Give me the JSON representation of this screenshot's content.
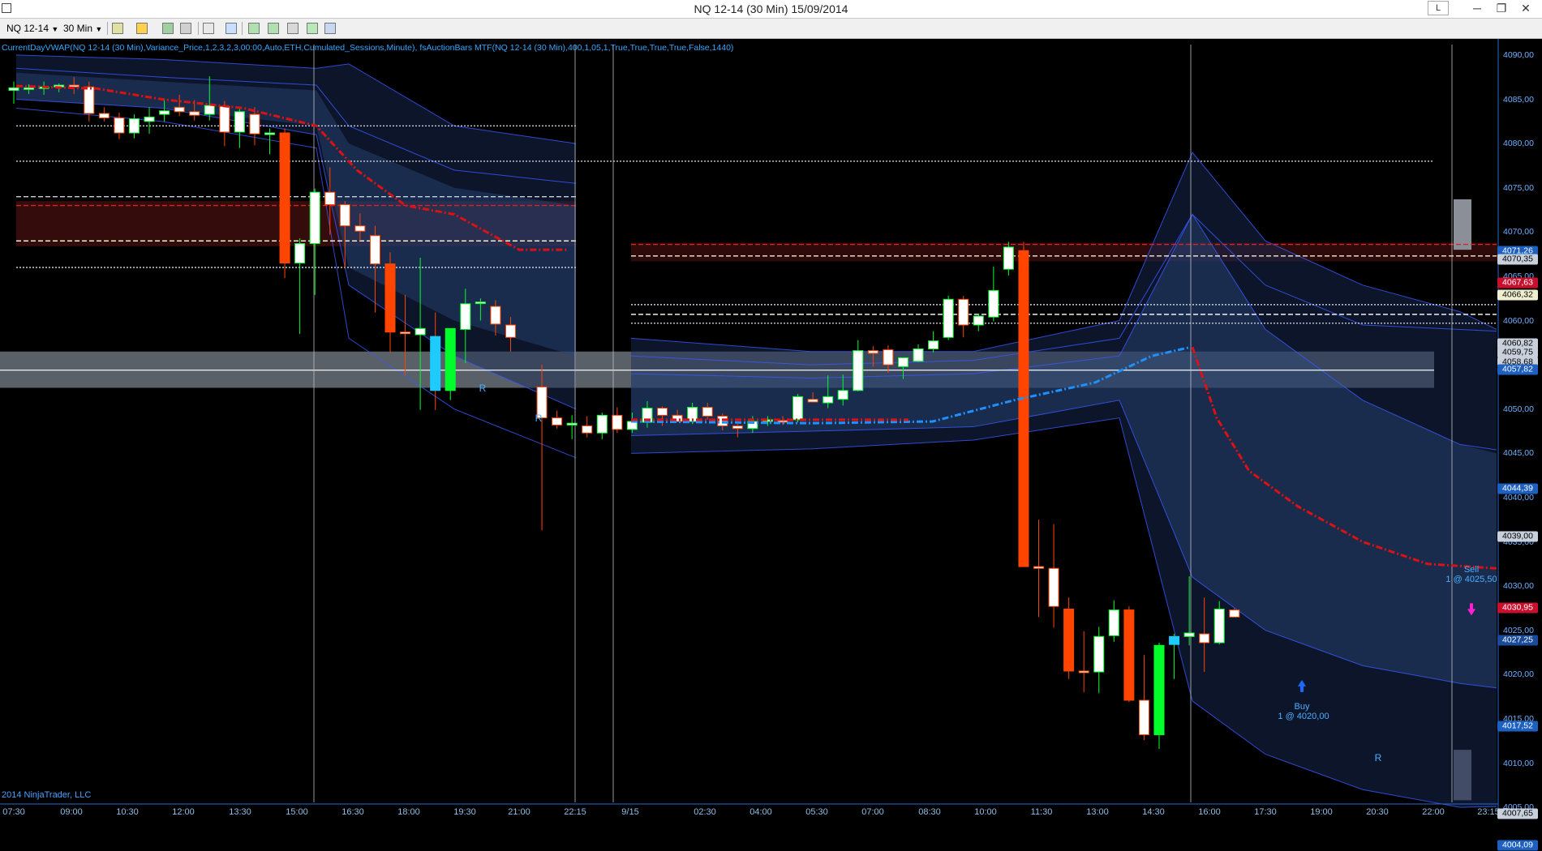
{
  "window": {
    "title": "NQ 12-14 (30 Min)  15/09/2014",
    "mode_button": "L",
    "minimize": "─",
    "restore": "❐",
    "close": "✕"
  },
  "toolbar": {
    "instrument": "NQ 12-14",
    "interval": "30 Min"
  },
  "indicator_text": "CurrentDayVWAP(NQ 12-14 (30 Min),Variance_Price,1,2,3,2,3,00:00,Auto,ETH,Cumulated_Sessions,Minute), fsAuctionBars MTF(NQ 12-14 (30 Min),400,1,05,1,True,True,True,True,False,1440)",
  "copyright": "2014 NinjaTrader, LLC",
  "time_axis": [
    "07:30",
    "09:00",
    "10:30",
    "12:00",
    "13:30",
    "15:00",
    "16:30",
    "18:00",
    "19:30",
    "21:00",
    "22:15",
    "9/15",
    "02:30",
    "04:00",
    "05:30",
    "07:00",
    "08:30",
    "10:00",
    "11:30",
    "13:00",
    "14:30",
    "16:00",
    "17:30",
    "19:00",
    "20:30",
    "22:00",
    "23:15"
  ],
  "price_axis": [
    "4090,00",
    "4085,00",
    "4080,00",
    "4075,00",
    "4070,00",
    "4065,00",
    "4060,00",
    "4055,00",
    "4050,00",
    "4045,00",
    "4040,00",
    "4035,00",
    "4030,00",
    "4025,00",
    "4020,00",
    "4015,00",
    "4010,00",
    "4005,00"
  ],
  "price_markers": [
    {
      "label": "4071,26",
      "bg": "#1e60c0",
      "fg": "#ffffff"
    },
    {
      "label": "4070,35",
      "bg": "#c8d0dc",
      "fg": "#000000"
    },
    {
      "label": "4067,63",
      "bg": "#c8102e",
      "fg": "#ffffff"
    },
    {
      "label": "4066,32",
      "bg": "#f0f0d0",
      "fg": "#000000"
    },
    {
      "label": "4060,82",
      "bg": "#c8d0dc",
      "fg": "#000000"
    },
    {
      "label": "4059,75",
      "bg": "#c8d0dc",
      "fg": "#000000"
    },
    {
      "label": "4058,68",
      "bg": "#c8d0dc",
      "fg": "#000000"
    },
    {
      "label": "4057,82",
      "bg": "#1e60c0",
      "fg": "#ffffff"
    },
    {
      "label": "4044,39",
      "bg": "#1e60c0",
      "fg": "#ffffff"
    },
    {
      "label": "4039,00",
      "bg": "#c8d0dc",
      "fg": "#000000"
    },
    {
      "label": "4030,95",
      "bg": "#c8102e",
      "fg": "#ffffff"
    },
    {
      "label": "4027,25",
      "bg": "#1a4a9a",
      "fg": "#ffffff"
    },
    {
      "label": "4017,52",
      "bg": "#1e60c0",
      "fg": "#ffffff"
    },
    {
      "label": "4007,65",
      "bg": "#c8d0dc",
      "fg": "#000000"
    },
    {
      "label": "4004,09",
      "bg": "#1e60c0",
      "fg": "#ffffff"
    }
  ],
  "annotations": {
    "sell_label": "Sell",
    "sell_detail": "1 @ 4025,50",
    "buy_label": "Buy",
    "buy_detail": "1 @ 4020,00",
    "r_marker": "R"
  },
  "colors": {
    "up": "#00ff2a",
    "down": "#ff4500",
    "vwap_day1": "#dd1111",
    "vwap_day2_blue": "#1e90ff",
    "band_line": "#3a5aff",
    "cyan_bar": "#1ecbff"
  },
  "chart_data": {
    "type": "candlestick",
    "title": "NQ 12-14 (30 Min)  15/09/2014",
    "y_axis_range": [
      4004,
      4091
    ],
    "candles": [
      {
        "t": "07:30",
        "o": 4085,
        "h": 4086,
        "l": 4083.5,
        "c": 4085.3
      },
      {
        "t": "08:00",
        "o": 4085.3,
        "h": 4085.7,
        "l": 4084.6,
        "c": 4085.3
      },
      {
        "t": "08:30",
        "o": 4085.3,
        "h": 4086,
        "l": 4084.5,
        "c": 4085.4
      },
      {
        "t": "09:00",
        "o": 4085.4,
        "h": 4085.8,
        "l": 4084.8,
        "c": 4085.6
      },
      {
        "t": "09:30",
        "o": 4085.6,
        "h": 4086.5,
        "l": 4084.6,
        "c": 4085.4
      },
      {
        "t": "10:00",
        "o": 4085.4,
        "h": 4086,
        "l": 4081.5,
        "c": 4082.4
      },
      {
        "t": "10:30",
        "o": 4082.4,
        "h": 4083.1,
        "l": 4081.5,
        "c": 4081.9
      },
      {
        "t": "11:00",
        "o": 4081.9,
        "h": 4082.5,
        "l": 4079.5,
        "c": 4080.2
      },
      {
        "t": "11:30",
        "o": 4080.2,
        "h": 4082.3,
        "l": 4079.6,
        "c": 4081.8
      },
      {
        "t": "12:00",
        "o": 4081.5,
        "h": 4083.1,
        "l": 4080.1,
        "c": 4082
      },
      {
        "t": "12:30",
        "o": 4082.3,
        "h": 4084.1,
        "l": 4081.5,
        "c": 4082.7
      },
      {
        "t": "13:00",
        "o": 4083.1,
        "h": 4084.5,
        "l": 4082.1,
        "c": 4082.6
      },
      {
        "t": "13:30",
        "o": 4082.6,
        "h": 4083.9,
        "l": 4081.6,
        "c": 4082.2
      },
      {
        "t": "14:00",
        "o": 4082.3,
        "h": 4086.6,
        "l": 4081.6,
        "c": 4083.3
      },
      {
        "t": "14:30",
        "o": 4083.2,
        "h": 4083.8,
        "l": 4078.7,
        "c": 4080.3
      },
      {
        "t": "15:00",
        "o": 4080.3,
        "h": 4082.9,
        "l": 4078.5,
        "c": 4082.6
      },
      {
        "t": "15:30",
        "o": 4082.3,
        "h": 4083.1,
        "l": 4078.8,
        "c": 4080.1
      },
      {
        "t": "16:00",
        "o": 4080.2,
        "h": 4080.7,
        "l": 4077.8,
        "c": 4080.2
      },
      {
        "t": "16:30",
        "o": 4080.2,
        "h": 4080.7,
        "l": 4063.8,
        "c": 4065.5
      },
      {
        "t": "17:00",
        "o": 4065.5,
        "h": 4068.3,
        "l": 4057.5,
        "c": 4067.7
      },
      {
        "t": "17:30",
        "o": 4067.7,
        "h": 4073.9,
        "l": 4061.9,
        "c": 4073.5
      },
      {
        "t": "18:00",
        "o": 4073.5,
        "h": 4076.3,
        "l": 4068.7,
        "c": 4072.1
      },
      {
        "t": "18:30",
        "o": 4072.1,
        "h": 4072.5,
        "l": 4064.9,
        "c": 4069.7
      },
      {
        "t": "19:00",
        "o": 4069.7,
        "h": 4071.1,
        "l": 4068,
        "c": 4069.1
      },
      {
        "t": "19:30",
        "o": 4068.6,
        "h": 4069.7,
        "l": 4059.9,
        "c": 4065.4
      },
      {
        "t": "20:00",
        "o": 4065.4,
        "h": 4066.7,
        "l": 4055.4,
        "c": 4057.7
      },
      {
        "t": "20:30",
        "o": 4057.7,
        "h": 4061.9,
        "l": 4052.8,
        "c": 4057.6
      },
      {
        "t": "21:00",
        "o": 4057.4,
        "h": 4066.1,
        "l": 4048.9,
        "c": 4058.1
      },
      {
        "t": "21:30",
        "o": 4057.2,
        "h": 4059.9,
        "l": 4048.9,
        "c": 4051.1
      },
      {
        "t": "22:00",
        "o": 4051.1,
        "h": 4058.1,
        "l": 4050,
        "c": 4058.1
      },
      {
        "t": "22:15",
        "o": 4058,
        "h": 4062.6,
        "l": 4054.2,
        "c": 4060.9
      },
      {
        "t": "22:30",
        "o": 4061,
        "h": 4061.5,
        "l": 4059,
        "c": 4061.1
      },
      {
        "t": "23:00",
        "o": 4060.6,
        "h": 4061.3,
        "l": 4057.3,
        "c": 4058.6
      },
      {
        "t": "23:30",
        "o": 4058.5,
        "h": 4059.4,
        "l": 4055.5,
        "c": 4057.1
      },
      {
        "t": "9/15 00:00",
        "o": 4051.5,
        "h": 4054,
        "l": 4035.3,
        "c": 4048
      },
      {
        "t": "00:30",
        "o": 4048,
        "h": 4048.8,
        "l": 4046.8,
        "c": 4047.2
      },
      {
        "t": "01:00",
        "o": 4047.2,
        "h": 4048.3,
        "l": 4045.6,
        "c": 4047.4
      },
      {
        "t": "01:30",
        "o": 4047.1,
        "h": 4048.2,
        "l": 4045.8,
        "c": 4046.3
      },
      {
        "t": "02:00",
        "o": 4046.3,
        "h": 4048.6,
        "l": 4045.6,
        "c": 4048.3
      },
      {
        "t": "02:30",
        "o": 4048.3,
        "h": 4049.2,
        "l": 4046.3,
        "c": 4046.7
      },
      {
        "t": "03:00",
        "o": 4046.7,
        "h": 4048.6,
        "l": 4046.3,
        "c": 4047.6
      },
      {
        "t": "03:30",
        "o": 4047.5,
        "h": 4049.9,
        "l": 4046.9,
        "c": 4049.1
      },
      {
        "t": "04:00",
        "o": 4049.1,
        "h": 4049.3,
        "l": 4047.1,
        "c": 4048.3
      },
      {
        "t": "04:30",
        "o": 4048.3,
        "h": 4048.9,
        "l": 4047.6,
        "c": 4047.6
      },
      {
        "t": "05:00",
        "o": 4047.6,
        "h": 4049.7,
        "l": 4047.3,
        "c": 4049.2
      },
      {
        "t": "05:30",
        "o": 4049.2,
        "h": 4049.7,
        "l": 4047.8,
        "c": 4048.2
      },
      {
        "t": "06:00",
        "o": 4048.2,
        "h": 4048.5,
        "l": 4046.6,
        "c": 4047.1
      },
      {
        "t": "06:30",
        "o": 4047.1,
        "h": 4047.3,
        "l": 4045.8,
        "c": 4046.8
      },
      {
        "t": "07:00",
        "o": 4046.8,
        "h": 4048.2,
        "l": 4046.3,
        "c": 4047.6
      },
      {
        "t": "07:30",
        "o": 4047.6,
        "h": 4048.2,
        "l": 4047.1,
        "c": 4047.8
      },
      {
        "t": "08:00",
        "o": 4047.7,
        "h": 4048.2,
        "l": 4047.2,
        "c": 4047.6
      },
      {
        "t": "08:30",
        "o": 4047.8,
        "h": 4050.7,
        "l": 4047.5,
        "c": 4050.4
      },
      {
        "t": "09:00",
        "o": 4050.1,
        "h": 4050.9,
        "l": 4049.8,
        "c": 4049.8
      },
      {
        "t": "09:30",
        "o": 4049.7,
        "h": 4052.8,
        "l": 4049.1,
        "c": 4050.4
      },
      {
        "t": "10:00",
        "o": 4050.1,
        "h": 4052.9,
        "l": 4049.4,
        "c": 4051.1
      },
      {
        "t": "10:30",
        "o": 4051.1,
        "h": 4056.8,
        "l": 4051,
        "c": 4055.6
      },
      {
        "t": "11:00",
        "o": 4055.6,
        "h": 4056.1,
        "l": 4053.8,
        "c": 4055.3
      },
      {
        "t": "11:30",
        "o": 4055.7,
        "h": 4056.2,
        "l": 4053.1,
        "c": 4054
      },
      {
        "t": "12:00",
        "o": 4053.8,
        "h": 4054.8,
        "l": 4052.4,
        "c": 4054.8
      },
      {
        "t": "12:30",
        "o": 4054.4,
        "h": 4056.3,
        "l": 4054.3,
        "c": 4055.8
      },
      {
        "t": "13:00",
        "o": 4055.8,
        "h": 4057.8,
        "l": 4055.4,
        "c": 4056.7
      },
      {
        "t": "13:30",
        "o": 4057.1,
        "h": 4061.8,
        "l": 4056.8,
        "c": 4061.4
      },
      {
        "t": "14:00",
        "o": 4061.4,
        "h": 4061.8,
        "l": 4057.1,
        "c": 4058.5
      },
      {
        "t": "14:30",
        "o": 4058.5,
        "h": 4059.8,
        "l": 4057.8,
        "c": 4059.5
      },
      {
        "t": "15:00",
        "o": 4059.4,
        "h": 4065.1,
        "l": 4058.9,
        "c": 4062.4
      },
      {
        "t": "15:30",
        "o": 4064.8,
        "h": 4067.9,
        "l": 4064.1,
        "c": 4067.3
      },
      {
        "t": "16:00",
        "o": 4066.9,
        "h": 4067.9,
        "l": 4031.2,
        "c": 4031.2
      },
      {
        "t": "16:30",
        "o": 4031.2,
        "h": 4036.5,
        "l": 4025.5,
        "c": 4031
      },
      {
        "t": "17:00",
        "o": 4031,
        "h": 4036,
        "l": 4024.3,
        "c": 4026.7
      },
      {
        "t": "17:30",
        "o": 4026.4,
        "h": 4027.7,
        "l": 4018.5,
        "c": 4019.4
      },
      {
        "t": "18:00",
        "o": 4019.4,
        "h": 4023.9,
        "l": 4017,
        "c": 4019.3
      },
      {
        "t": "18:30",
        "o": 4019.3,
        "h": 4024.4,
        "l": 4016.9,
        "c": 4023.3
      },
      {
        "t": "19:00",
        "o": 4023.4,
        "h": 4027.4,
        "l": 4022.7,
        "c": 4026.3
      },
      {
        "t": "19:30",
        "o": 4026.3,
        "h": 4026.7,
        "l": 4015.9,
        "c": 4016.1
      },
      {
        "t": "20:00",
        "o": 4016.1,
        "h": 4021.2,
        "l": 4011.6,
        "c": 4012.2
      },
      {
        "t": "20:30",
        "o": 4012.2,
        "h": 4022.6,
        "l": 4010.6,
        "c": 4022.3
      },
      {
        "t": "21:00",
        "o": 4022.4,
        "h": 4023.6,
        "l": 4018.5,
        "c": 4023.3
      },
      {
        "t": "21:30",
        "o": 4023.3,
        "h": 4030.1,
        "l": 4022.3,
        "c": 4023.7
      },
      {
        "t": "22:00",
        "o": 4023.6,
        "h": 4027.7,
        "l": 4019.3,
        "c": 4022.6
      },
      {
        "t": "22:30",
        "o": 4022.6,
        "h": 4027.3,
        "l": 4022.4,
        "c": 4026.4
      },
      {
        "t": "23:00",
        "o": 4026.3,
        "h": 4026.5,
        "l": 4025.5,
        "c": 4025.5
      }
    ]
  }
}
